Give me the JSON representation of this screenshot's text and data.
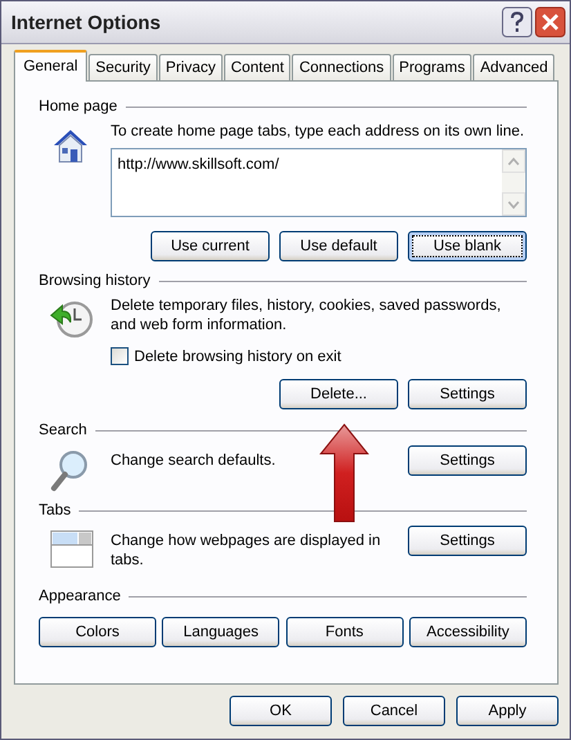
{
  "window": {
    "title": "Internet Options"
  },
  "tabs": [
    {
      "label": "General",
      "selected": true
    },
    {
      "label": "Security",
      "selected": false
    },
    {
      "label": "Privacy",
      "selected": false
    },
    {
      "label": "Content",
      "selected": false
    },
    {
      "label": "Connections",
      "selected": false
    },
    {
      "label": "Programs",
      "selected": false
    },
    {
      "label": "Advanced",
      "selected": false
    }
  ],
  "sections": [
    {
      "kind": "home",
      "heading": "Home page",
      "description": "To create home page tabs, type each address on its own line.",
      "url": "http://www.skillsoft.com/",
      "buttons": [
        {
          "label": "Use current",
          "focused": false
        },
        {
          "label": "Use default",
          "focused": false
        },
        {
          "label": "Use blank",
          "focused": true
        }
      ]
    },
    {
      "kind": "history",
      "heading": "Browsing history",
      "description": "Delete temporary files, history, cookies, saved passwords, and web form information.",
      "checkbox": {
        "label": "Delete browsing history on exit",
        "checked": false
      },
      "buttons": [
        {
          "label": "Delete...",
          "focused": false
        },
        {
          "label": "Settings",
          "focused": false
        }
      ]
    },
    {
      "kind": "search",
      "heading": "Search",
      "description": "Change search defaults.",
      "buttons": [
        {
          "label": "Settings",
          "focused": false
        }
      ]
    },
    {
      "kind": "tabs",
      "heading": "Tabs",
      "description": "Change how webpages are displayed in tabs.",
      "buttons": [
        {
          "label": "Settings",
          "focused": false
        }
      ]
    },
    {
      "kind": "appearance",
      "heading": "Appearance",
      "buttons": [
        {
          "label": "Colors",
          "focused": false
        },
        {
          "label": "Languages",
          "focused": false
        },
        {
          "label": "Fonts",
          "focused": false
        },
        {
          "label": "Accessibility",
          "focused": false
        }
      ]
    }
  ],
  "footer_buttons": [
    "OK",
    "Cancel",
    "Apply"
  ]
}
